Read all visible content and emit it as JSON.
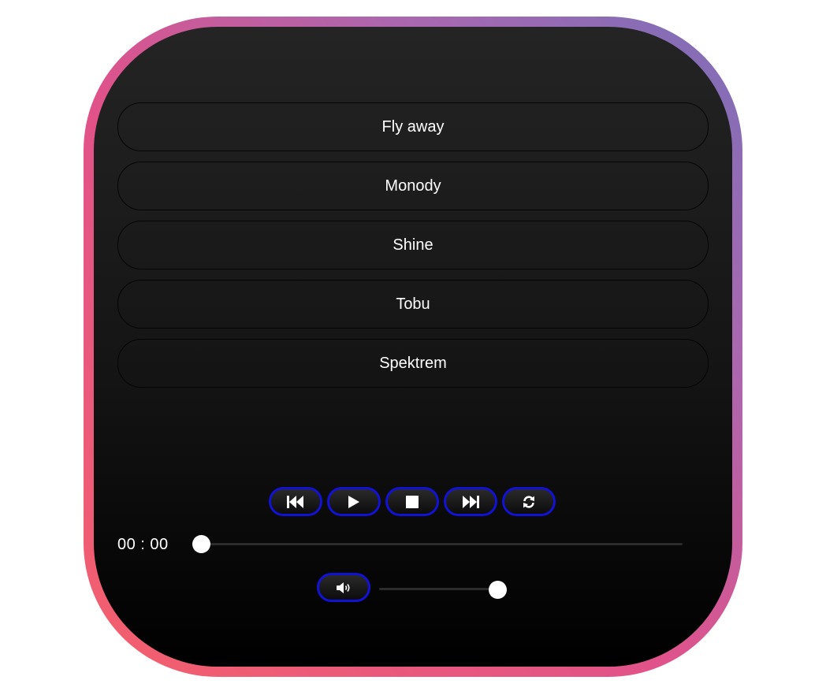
{
  "playlist": [
    {
      "title": "Fly away"
    },
    {
      "title": "Monody"
    },
    {
      "title": "Shine"
    },
    {
      "title": "Tobu"
    },
    {
      "title": "Spektrem"
    }
  ],
  "controls": {
    "prev_icon": "skip-back-icon",
    "play_icon": "play-icon",
    "stop_icon": "stop-icon",
    "next_icon": "skip-forward-icon",
    "repeat_icon": "repeat-icon"
  },
  "progress": {
    "time": "00 : 00",
    "position_fraction": 0
  },
  "volume": {
    "icon": "volume-icon",
    "level_fraction": 1
  },
  "colors": {
    "button_border": "#1212d4",
    "frame_gradient": [
      "#f4606c",
      "#e0528a",
      "#a868b0",
      "#7a6fb8"
    ]
  }
}
